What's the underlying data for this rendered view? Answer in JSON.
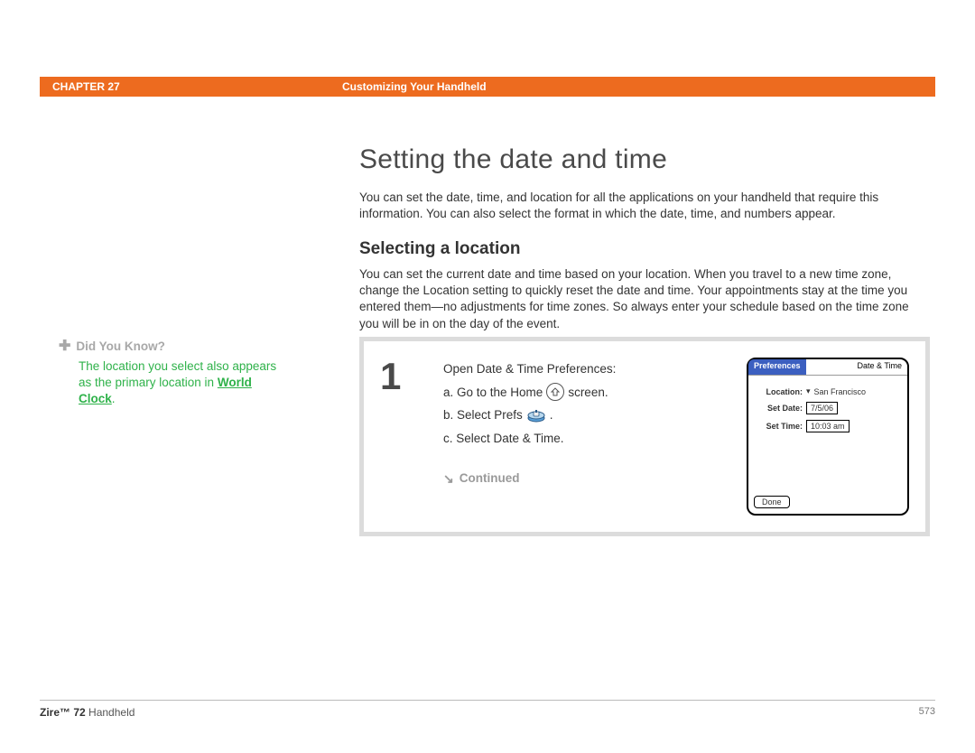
{
  "header": {
    "chapter": "CHAPTER 27",
    "title": "Customizing Your Handheld"
  },
  "main": {
    "heading": "Setting the date and time",
    "intro": "You can set the date, time, and location for all the applications on your handheld that require this information. You can also select the format in which the date, time, and numbers appear.",
    "sub_heading": "Selecting a location",
    "sub_para": "You can set the current date and time based on your location. When you travel to a new time zone, change the Location setting to quickly reset the date and time. Your appointments stay at the time you entered them—no adjustments for time zones. So always enter your schedule based on the time zone you will be in on the day of the event."
  },
  "sidebar": {
    "dyk_label": "Did You Know?",
    "dyk_text_1": "The location you select also appears as the primary location in ",
    "dyk_link": "World Clock",
    "dyk_text_2": "."
  },
  "step": {
    "number": "1",
    "title": "Open Date & Time Preferences:",
    "a_pre": "a.  Go to the Home ",
    "a_post": " screen.",
    "b_pre": "b.  Select Prefs ",
    "b_post": " .",
    "c": "c.  Select Date & Time.",
    "continued": "Continued"
  },
  "device": {
    "tab_left": "Preferences",
    "tab_right": "Date & Time",
    "location_label": "Location:",
    "location_value": "San Francisco",
    "date_label": "Set Date:",
    "date_value": "7/5/06",
    "time_label": "Set Time:",
    "time_value": "10:03 am",
    "done": "Done"
  },
  "footer": {
    "product_bold": "Zire™ 72",
    "product_rest": " Handheld",
    "page": "573"
  }
}
